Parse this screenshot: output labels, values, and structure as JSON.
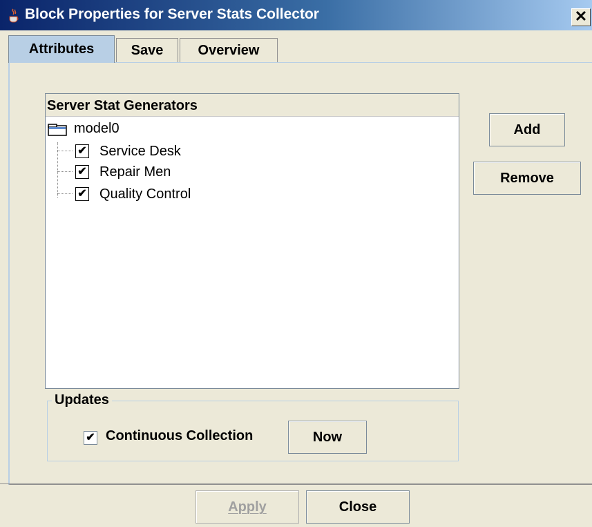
{
  "window": {
    "title": "Block Properties for Server Stats Collector",
    "icon": "java-cup-icon",
    "close_glyph": "✕"
  },
  "tabs": [
    {
      "label": "Attributes",
      "active": true
    },
    {
      "label": "Save",
      "active": false
    },
    {
      "label": "Overview",
      "active": false
    }
  ],
  "tree": {
    "header": "Server Stat Generators",
    "root": {
      "label": "model0",
      "icon": "folder-icon"
    },
    "items": [
      {
        "label": "Service Desk",
        "checked": true
      },
      {
        "label": "Repair Men",
        "checked": true
      },
      {
        "label": "Quality Control",
        "checked": true
      }
    ]
  },
  "side_buttons": {
    "add": "Add",
    "remove": "Remove"
  },
  "updates": {
    "title": "Updates",
    "continuous_label": "Continuous Collection",
    "continuous_checked": true,
    "now_button": "Now"
  },
  "footer": {
    "apply": "Apply",
    "apply_enabled": false,
    "close": "Close"
  },
  "colors": {
    "title_gradient_start": "#0a246a",
    "title_gradient_end": "#a6caf0",
    "active_tab": "#b8cfe5",
    "dialog_bg": "#ece9d8"
  }
}
